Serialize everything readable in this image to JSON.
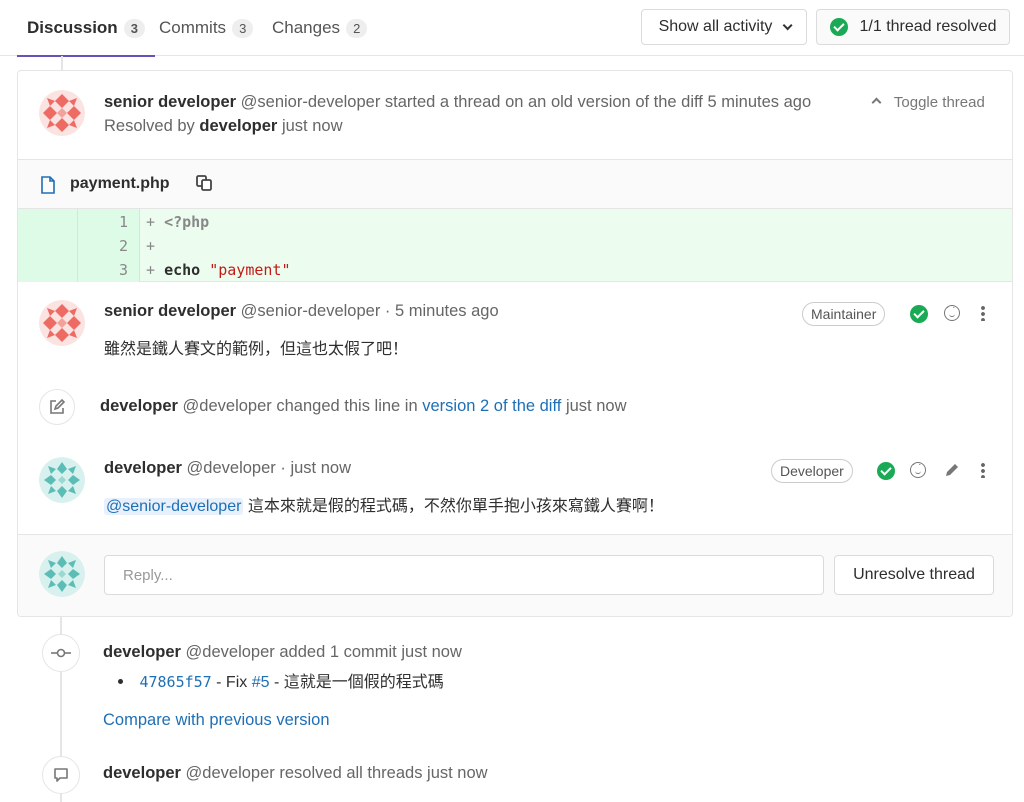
{
  "tabs": [
    {
      "label": "Discussion",
      "count": "3"
    },
    {
      "label": "Commits",
      "count": "3"
    },
    {
      "label": "Changes",
      "count": "2"
    }
  ],
  "toolbar": {
    "activity_filter": "Show all activity",
    "resolved_status": "1/1 thread resolved"
  },
  "thread": {
    "author_name": "senior developer",
    "author_handle": "@senior-developer",
    "action": "started a thread on an old version of the diff",
    "time": "5 minutes ago",
    "toggle_label": "Toggle thread",
    "resolved_prefix": "Resolved by",
    "resolved_by": "developer",
    "resolved_time": "just now"
  },
  "file": {
    "name": "payment.php",
    "lines": [
      {
        "num": "1",
        "prefix": "+",
        "code": "<?php"
      },
      {
        "num": "2",
        "prefix": "+",
        "code": ""
      },
      {
        "num": "3",
        "prefix": "+",
        "kw": "echo",
        "str": "\"payment\""
      }
    ]
  },
  "comments": [
    {
      "author_name": "senior developer",
      "author_handle": "@senior-developer",
      "time": "· 5 minutes ago",
      "role": "Maintainer",
      "body": "雖然是鐵人賽文的範例，但這也太假了吧！"
    },
    {
      "author_name": "developer",
      "author_handle": "@developer",
      "time": "· just now",
      "role": "Developer",
      "mention": "@senior-developer",
      "body": "這本來就是假的程式碼，不然你單手抱小孩來寫鐵人賽啊！"
    }
  ],
  "system_note": {
    "author_name": "developer",
    "author_handle": "@developer",
    "action": "changed this line in",
    "link": "version 2 of the diff",
    "time": "just now"
  },
  "reply": {
    "placeholder": "Reply...",
    "unresolve_label": "Unresolve thread"
  },
  "timeline": {
    "commit_note": {
      "author_name": "developer",
      "author_handle": "@developer",
      "action": "added 1 commit just now",
      "sha": "47865f57",
      "message_prefix": "- Fix",
      "issue": "#5",
      "message_suffix": "- 這就是一個假的程式碼",
      "compare_link": "Compare with previous version"
    },
    "resolved_note": {
      "author_name": "developer",
      "author_handle": "@developer",
      "action": "resolved all threads just now"
    }
  },
  "colors": {
    "accent": "#6b4fbb",
    "success": "#1aaa55",
    "link": "#1f6fb5",
    "diff_add_bg": "#ecfdf0"
  }
}
